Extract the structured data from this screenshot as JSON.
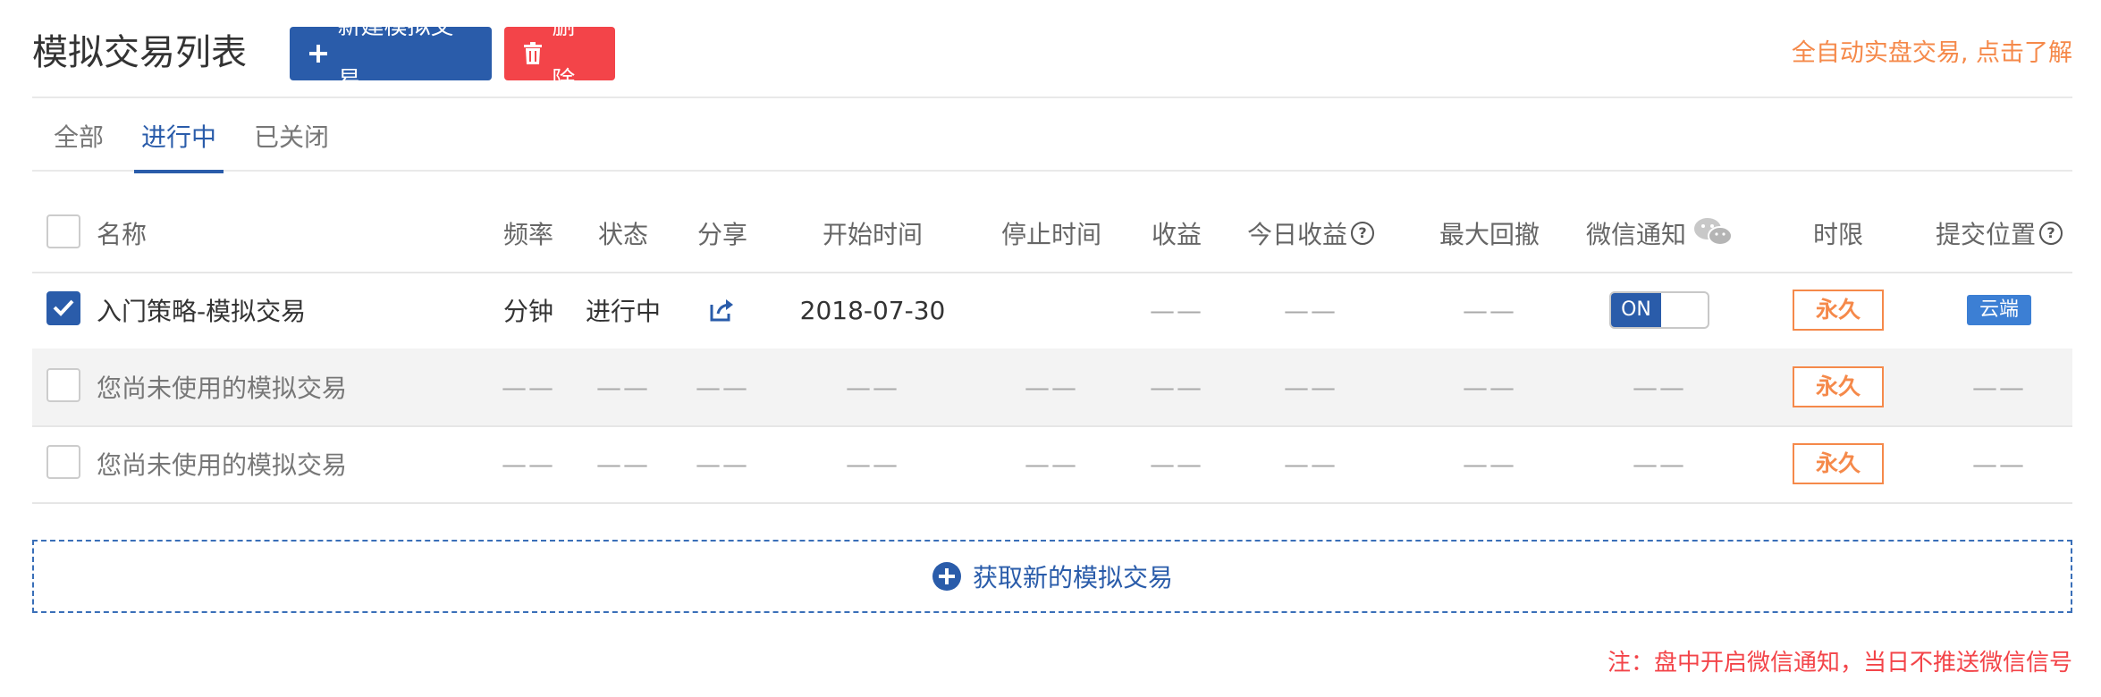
{
  "header": {
    "title": "模拟交易列表",
    "new_button": "新建模拟交易",
    "delete_button": "删除",
    "auto_trade_link": "全自动实盘交易, 点击了解"
  },
  "tabs": [
    {
      "label": "全部",
      "active": false
    },
    {
      "label": "进行中",
      "active": true
    },
    {
      "label": "已关闭",
      "active": false
    }
  ],
  "table": {
    "columns": {
      "name": "名称",
      "frequency": "频率",
      "status": "状态",
      "share": "分享",
      "start_time": "开始时间",
      "stop_time": "停止时间",
      "profit": "收益",
      "today_profit": "今日收益",
      "max_drawdown": "最大回撤",
      "wechat_notify": "微信通知",
      "time_limit": "时限",
      "submit_location": "提交位置"
    },
    "rows": [
      {
        "checked": true,
        "name": "入门策略-模拟交易",
        "frequency": "分钟",
        "status": "进行中",
        "start_time": "2018-07-30",
        "stop_time": "",
        "profit": "——",
        "today_profit": "——",
        "max_drawdown": "——",
        "wechat_toggle": "ON",
        "time_limit": "永久",
        "submit_location": "云端"
      },
      {
        "checked": false,
        "name": "您尚未使用的模拟交易",
        "frequency": "——",
        "status": "——",
        "share": "——",
        "start_time": "——",
        "stop_time": "——",
        "profit": "——",
        "today_profit": "——",
        "max_drawdown": "——",
        "wechat": "——",
        "time_limit": "永久",
        "submit_location": "——"
      },
      {
        "checked": false,
        "name": "您尚未使用的模拟交易",
        "frequency": "——",
        "status": "——",
        "share": "——",
        "start_time": "——",
        "stop_time": "——",
        "profit": "——",
        "today_profit": "——",
        "max_drawdown": "——",
        "wechat": "——",
        "time_limit": "永久",
        "submit_location": "——"
      }
    ]
  },
  "add_new": "获取新的模拟交易",
  "note": "注：盘中开启微信通知，当日不推送微信信号",
  "icons": {
    "new": "plus-icon",
    "delete": "trash-icon",
    "share": "share-icon",
    "help": "question-circle-icon",
    "wechat": "wechat-icon",
    "add": "plus-circle-icon"
  },
  "colors": {
    "primary": "#2a5caa",
    "danger": "#f34449",
    "accent_orange": "#f5894a",
    "cloud_badge": "#3c7fd4"
  }
}
